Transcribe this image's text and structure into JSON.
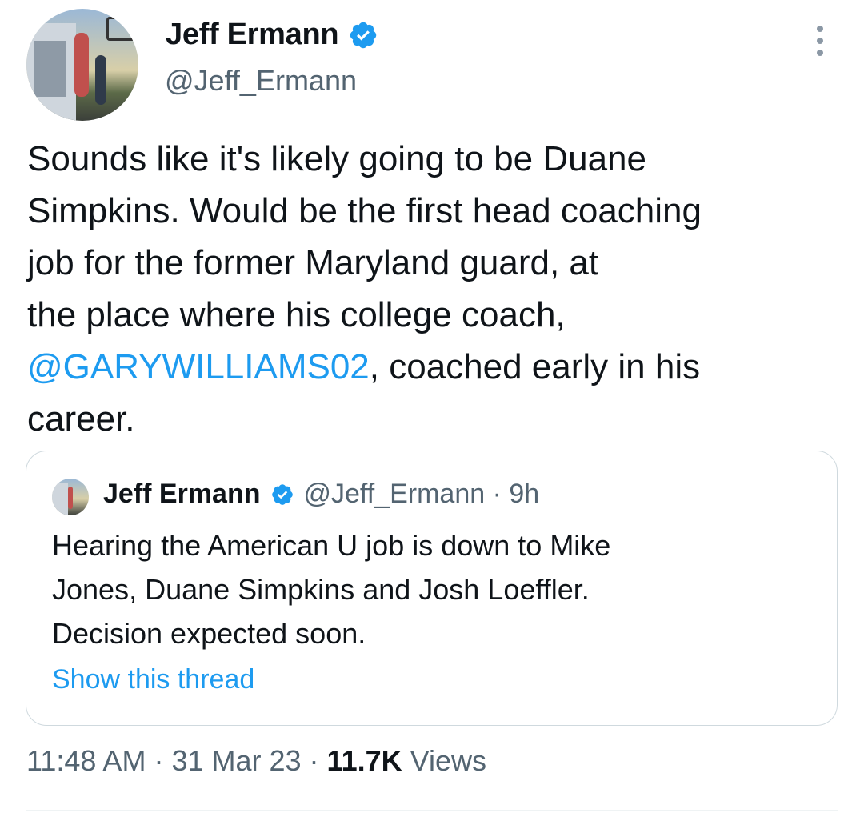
{
  "author": {
    "name": "Jeff Ermann",
    "handle": "@Jeff_Ermann",
    "verified_color": "#1d9bf0"
  },
  "tweet": {
    "lines": [
      "Sounds like it's likely going to be Duane",
      "Simpkins. Would be the first head coaching",
      "job for the former Maryland guard, at",
      "the place where his college coach,"
    ],
    "mention": "@GARYWILLIAMS02",
    "line5_rest": ",  coached early in his",
    "line6": "career."
  },
  "quote": {
    "name": "Jeff Ermann",
    "handle": "@Jeff_Ermann",
    "separator": " · ",
    "time": "9h",
    "lines": [
      "Hearing the American U job  is down to Mike",
      "Jones, Duane Simpkins and Josh Loeffler.",
      "Decision expected soon."
    ],
    "show_thread": "Show this thread"
  },
  "meta": {
    "time": "11:48 AM",
    "date": "31 Mar 23",
    "views_count": "11.7K",
    "views_label": "Views",
    "sep": " · "
  },
  "icons": {
    "verified": "verified-badge-icon",
    "more": "more-options-icon"
  }
}
